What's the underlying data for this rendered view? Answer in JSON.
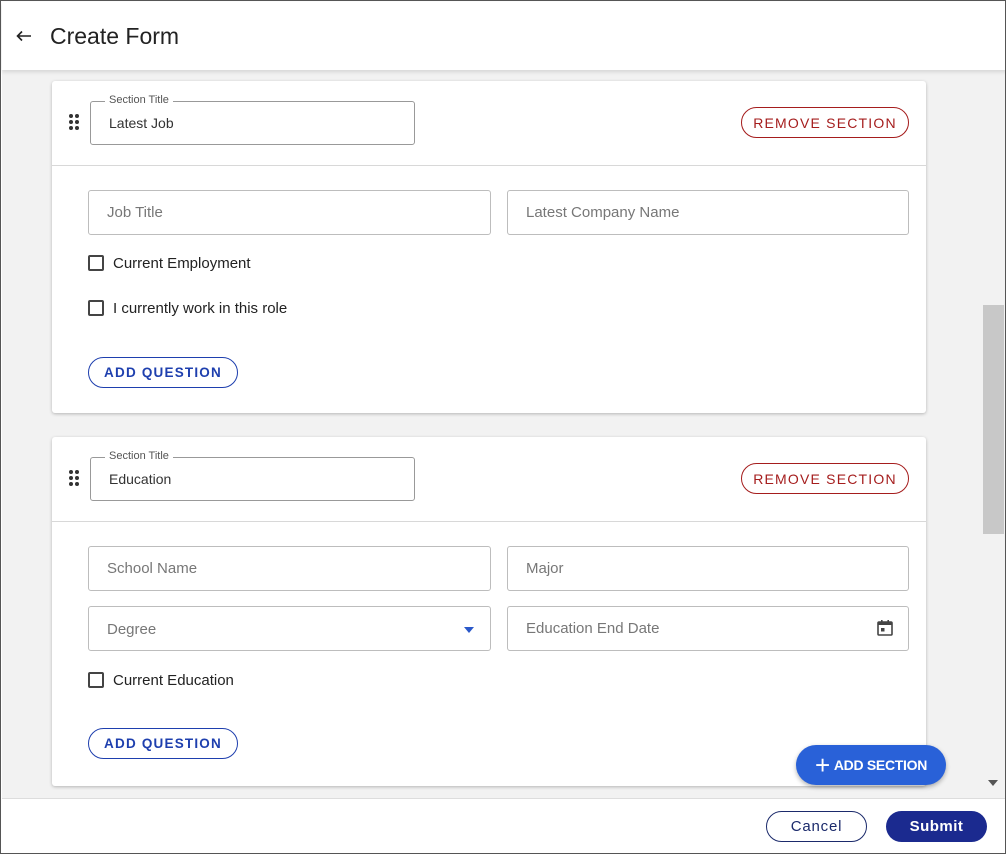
{
  "header": {
    "title": "Create Form"
  },
  "sections": [
    {
      "legend": "Section Title",
      "title_value": "Latest Job",
      "remove_label": "REMOVE SECTION",
      "fields": [
        "Job Title",
        "Latest Company Name"
      ],
      "checkboxes": [
        "Current Employment",
        "I currently work in this role"
      ],
      "add_question_label": "ADD QUESTION"
    },
    {
      "legend": "Section Title",
      "title_value": "Education",
      "remove_label": "REMOVE SECTION",
      "fields": [
        "School Name",
        "Major"
      ],
      "degree_placeholder": "Degree",
      "end_date_placeholder": "Education End Date",
      "checkboxes": [
        "Current Education"
      ],
      "add_question_label": "ADD QUESTION"
    }
  ],
  "fab": {
    "label": "ADD SECTION"
  },
  "footer": {
    "cancel_label": "Cancel",
    "submit_label": "Submit"
  },
  "icons": {
    "back": "arrow-left-icon",
    "drag": "drag-handle-icon",
    "dropdown": "caret-down-icon",
    "calendar": "calendar-icon",
    "plus": "plus-icon"
  },
  "colors": {
    "danger": "#a51d1d",
    "primary": "#1e3fae",
    "fab": "#2961d8",
    "submit": "#1b2a8f"
  }
}
